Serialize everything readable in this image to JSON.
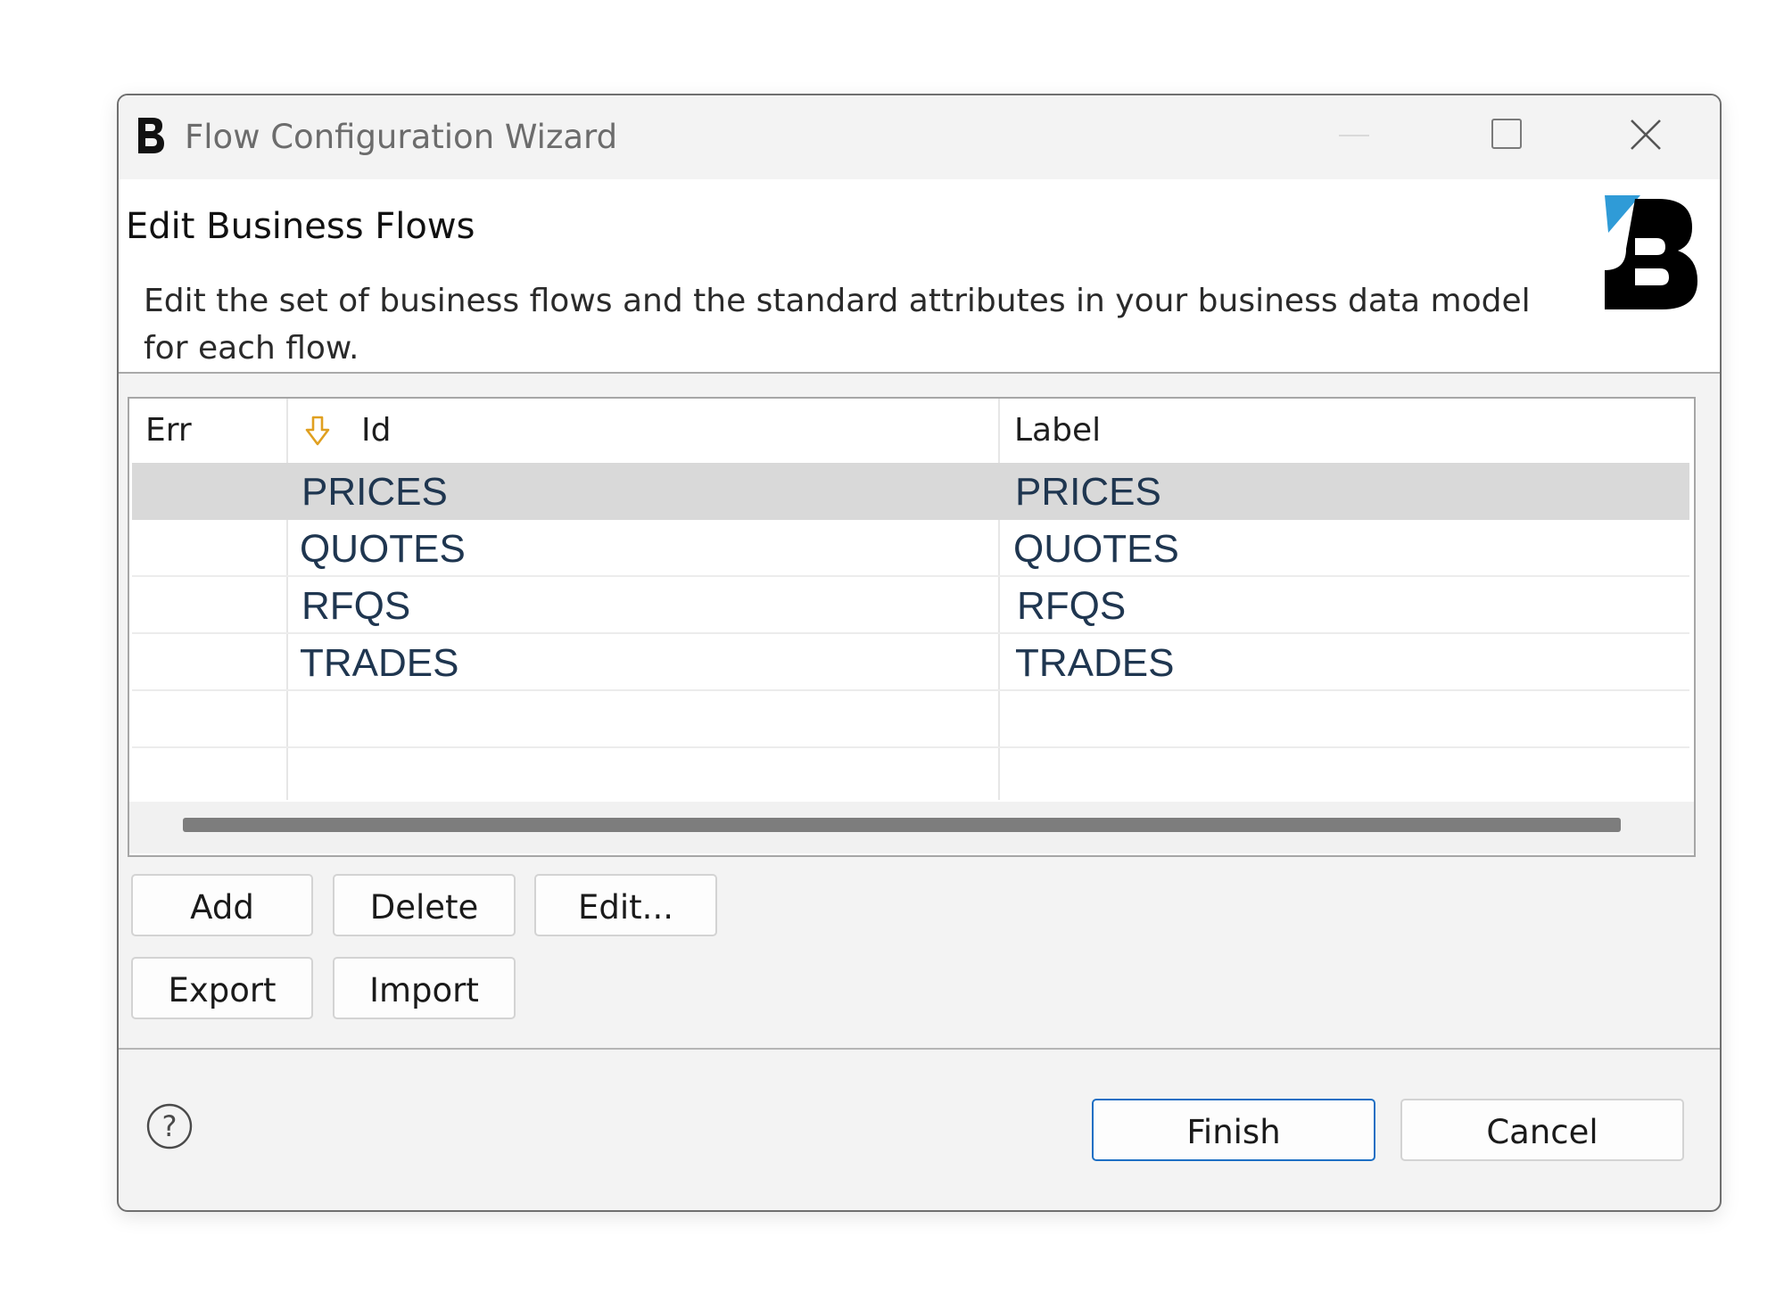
{
  "window": {
    "title": "Flow Configuration Wizard",
    "icons": {
      "app": "b-logo-icon",
      "minimize": "minimize-icon",
      "maximize": "maximize-icon",
      "close": "close-icon"
    }
  },
  "banner": {
    "title": "Edit Business Flows",
    "description": "Edit the set of business flows and the standard attributes in your business data model for each flow.",
    "logo": "b-logo",
    "colors": {
      "logo_black": "#000000",
      "logo_accent": "#2f9bd7"
    }
  },
  "table": {
    "columns": [
      "Err",
      "Id",
      "Label"
    ],
    "sort_icon": "sort-down-arrow-icon",
    "sort_color": "#e0a020",
    "rows": [
      {
        "err": "",
        "id": "PRICES",
        "label": "PRICES",
        "selected": true
      },
      {
        "err": "",
        "id": "QUOTES",
        "label": "QUOTES",
        "selected": false
      },
      {
        "err": "",
        "id": "RFQS",
        "label": "RFQS",
        "selected": false
      },
      {
        "err": "",
        "id": "TRADES",
        "label": "TRADES",
        "selected": false
      }
    ]
  },
  "buttons": {
    "add": "Add",
    "delete": "Delete",
    "edit": "Edit...",
    "export": "Export",
    "import": "Import",
    "finish": "Finish",
    "cancel": "Cancel"
  },
  "footer": {
    "help_icon": "help-icon",
    "accent": "#1d6fc4"
  }
}
